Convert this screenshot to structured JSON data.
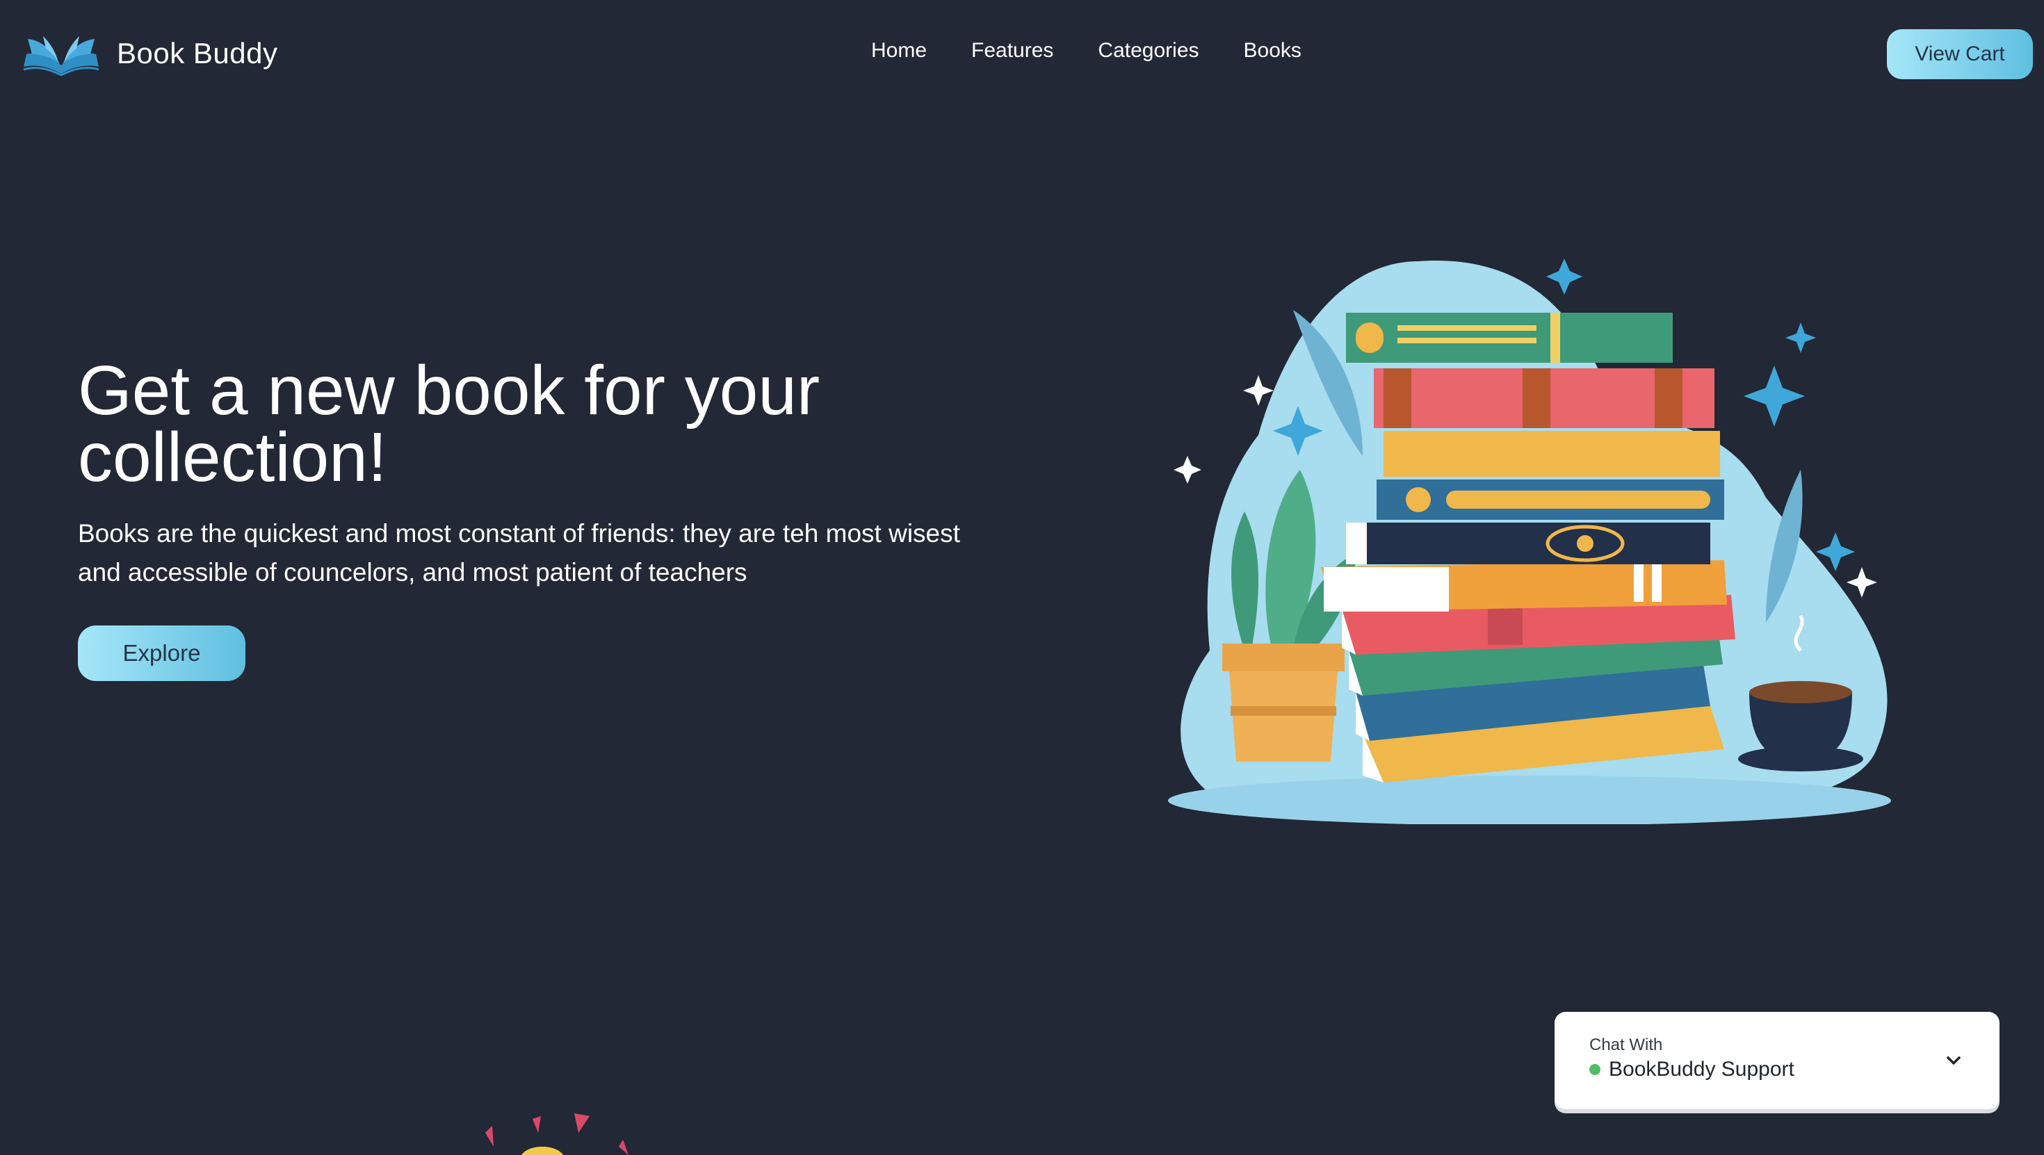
{
  "nav": {
    "brand": "Book Buddy",
    "links": [
      "Home",
      "Features",
      "Categories",
      "Books"
    ],
    "cart_button": "View Cart"
  },
  "hero": {
    "title": "Get a new book for your collection!",
    "subtitle": "Books are the quickest and most constant of friends: they are teh most wisest and accessible of councelors, and most patient of teachers",
    "cta": "Explore"
  },
  "chat": {
    "label": "Chat With",
    "name": "BookBuddy Support"
  },
  "colors": {
    "background": "#222835",
    "button_gradient_start": "#a6e6f8",
    "button_gradient_end": "#5fbfe0",
    "online": "#4cc063"
  },
  "icons": {
    "brand": "open-book-icon",
    "chat_toggle": "chevron-down-icon"
  }
}
